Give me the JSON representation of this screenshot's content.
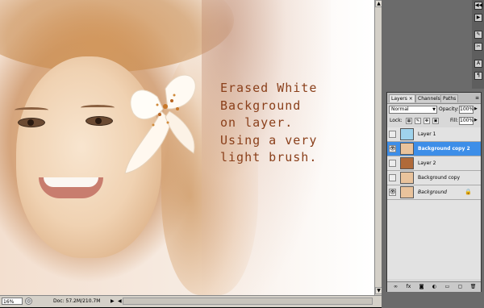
{
  "canvas": {
    "caption_lines": [
      "Erased White",
      "Background",
      "on layer.",
      "Using a very",
      "light brush."
    ],
    "caption_color": "#8a3f1a"
  },
  "status_bar": {
    "zoom": "16%",
    "doc_info": "Doc: 57.2M/210.7M",
    "arrow_right": "▶",
    "arrow_left": "◀"
  },
  "dock": {
    "buttons": [
      "◀◀",
      "▶",
      "✎",
      "✂",
      "A",
      "¶"
    ]
  },
  "layers_panel": {
    "tabs": [
      {
        "label": "Layers ×",
        "active": true
      },
      {
        "label": "Channels",
        "active": false
      },
      {
        "label": "Paths",
        "active": false
      }
    ],
    "blend_mode": "Normal",
    "opacity_label": "Opacity:",
    "opacity_value": "100%",
    "lock_label": "Lock:",
    "fill_label": "Fill:",
    "fill_value": "100%",
    "layers": [
      {
        "name": "Layer 1",
        "visible": false,
        "selected": false,
        "thumb": "#9fd3ec",
        "italic": false,
        "locked": false
      },
      {
        "name": "Background copy 2",
        "visible": true,
        "selected": true,
        "thumb": "#e9c39c",
        "italic": false,
        "locked": false
      },
      {
        "name": "Layer 2",
        "visible": false,
        "selected": false,
        "thumb": "#b06a3a",
        "italic": false,
        "locked": false
      },
      {
        "name": "Background copy",
        "visible": false,
        "selected": false,
        "thumb": "#e9c39c",
        "italic": false,
        "locked": false
      },
      {
        "name": "Background",
        "visible": true,
        "selected": false,
        "thumb": "#e9c39c",
        "italic": true,
        "locked": true
      }
    ],
    "footer_icons": [
      "link-icon",
      "fx-icon",
      "mask-icon",
      "adjustment-icon",
      "group-icon",
      "new-layer-icon",
      "trash-icon"
    ]
  }
}
